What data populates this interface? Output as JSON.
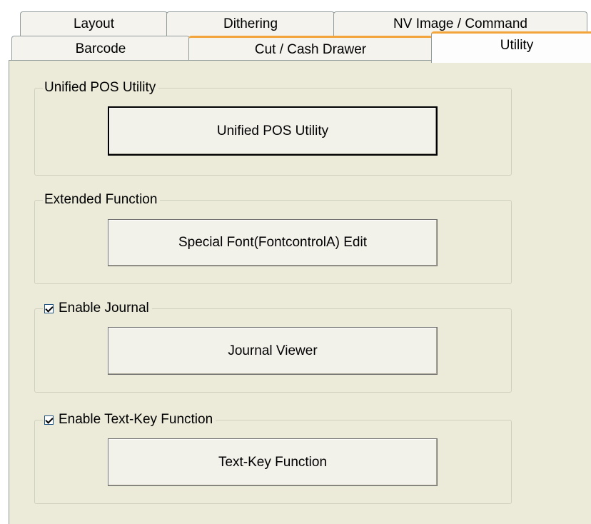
{
  "tabs": {
    "row1": [
      "Layout",
      "Dithering",
      "NV Image / Command"
    ],
    "row2": [
      "Barcode",
      "Cut / Cash Drawer",
      "Utility"
    ]
  },
  "groups": {
    "upos": {
      "title": "Unified POS Utility",
      "button": "Unified POS Utility"
    },
    "extended": {
      "title": "Extended Function",
      "button": "Special Font(FontcontrolA) Edit"
    },
    "journal": {
      "title": "Enable Journal",
      "checked": true,
      "button": "Journal Viewer"
    },
    "textkey": {
      "title": "Enable Text-Key Function",
      "checked": true,
      "button": "Text-Key Function"
    }
  },
  "colors": {
    "panel": "#ecead8",
    "tab_hot": "#f3a53b",
    "border": "#919b9c"
  }
}
